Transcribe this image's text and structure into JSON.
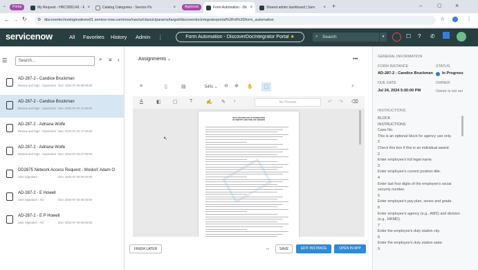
{
  "browser": {
    "tabs": [
      {
        "label": "Portal",
        "type": "pill",
        "color": "#a04fa8"
      },
      {
        "label": "My Request - HRC3001141 - Ex",
        "type": "tab"
      },
      {
        "label": "Catalog Categories - Service Po",
        "type": "tab"
      },
      {
        "label": "Approval",
        "type": "pill",
        "color": "#a04fa8"
      },
      {
        "label": "Form Automation - DiscoverDoc",
        "type": "tab",
        "active": true
      },
      {
        "label": "Shared admin dashboard | Serv",
        "type": "tab"
      }
    ],
    "url": "discovertechnologiesdemo01.service-now.com/now/nav/ui/classic/params/target/discoverdocintegratorportal%3Fid%3Dform_automation"
  },
  "header": {
    "logo": "servicenow",
    "nav": [
      "All",
      "Favorites",
      "History",
      "Admin"
    ],
    "context_title": "Form Automation - DiscoverDocIntegrator Portal",
    "search_placeholder": "Search"
  },
  "left": {
    "search_placeholder": "Search...",
    "items": [
      {
        "title": "AD-287-2 - Candice Bruckman",
        "sub": "Review and Sign - Supervisor",
        "due": "Due: 2024-07-29 00:00:00"
      },
      {
        "title": "AD-287-2 - Candice Bruckman",
        "sub": "Review and Sign - Supervisor",
        "due": "Due: 2024-07-24 17:00:00",
        "selected": true
      },
      {
        "title": "AD-287-2 - Adriana Wolfe",
        "sub": "Review and Sign - Supervisor",
        "due": "Due: 2024-07-24 17:00:00"
      },
      {
        "title": "AD-287-2 - Adriana Wolfe",
        "sub": "Review and Sign - Supervisor",
        "due": "Due: 2024-07-23 17:00:00"
      },
      {
        "title": "DD2875 Network Access Request - Moskof, Adam O",
        "sub": "User Signature",
        "due": "Due: 2024-07-26 00:00:00"
      },
      {
        "title": "AD-287-2 - E Howell",
        "sub": "User Signature - AD",
        "due": "Due: 2024-07-26 00:00:00"
      },
      {
        "title": "AD-287-2 - E P Howell",
        "sub": "User Signature - AD",
        "due": "Due: 2024-07-26 00:00:00"
      }
    ]
  },
  "center": {
    "dropdown": "Assignments",
    "zoom": "54%",
    "presets_label": "No Presets",
    "doc_title_line1": "DECLARATION FOR AUTHORIZATION",
    "doc_title_line2": "OF IDENTITY AND TIME OFF AWARDS",
    "buttons": {
      "finish_later": "FINISH LATER",
      "more": "...",
      "save": "SAVE",
      "edit_instance": "EDIT INSTANCE",
      "open_in_app": "OPEN IN APP"
    }
  },
  "right": {
    "section_general": "GENERAL INFORMATION",
    "form_instance_label": "FORM INSTANCE",
    "form_instance_value": "AD-287-2 - Candice Bruckman",
    "status_label": "STATUS",
    "status_value": "In Progress",
    "status_color": "#2f7dd1",
    "due_date_label": "DUE DATE",
    "due_date_value": "Jul 24, 2024 5:00:00 PM",
    "owner_label": "OWNER",
    "owner_value": "Owner is not set",
    "instructions_title": "INSTRUCTIONS",
    "instructions": [
      "BLOCK",
      "INSTRUCTIONS",
      "Case No.",
      "This is an optional block for agency use only.",
      "2",
      "Check this box if this is an individual award.",
      "2",
      "Enter employee's full legal name.",
      "3",
      "Enter employee's current position title.",
      "4",
      "Enter last four digits of the employee's social security number.",
      "5",
      "Enter employee's pay plan, series and grade.",
      "6",
      "Enter employee's agency (e.g., AMS) and division (e.g., HRMD).",
      "7",
      "Enter the employee's duty station city.",
      "8",
      "Enter the employee's duty station state.",
      "9"
    ]
  }
}
